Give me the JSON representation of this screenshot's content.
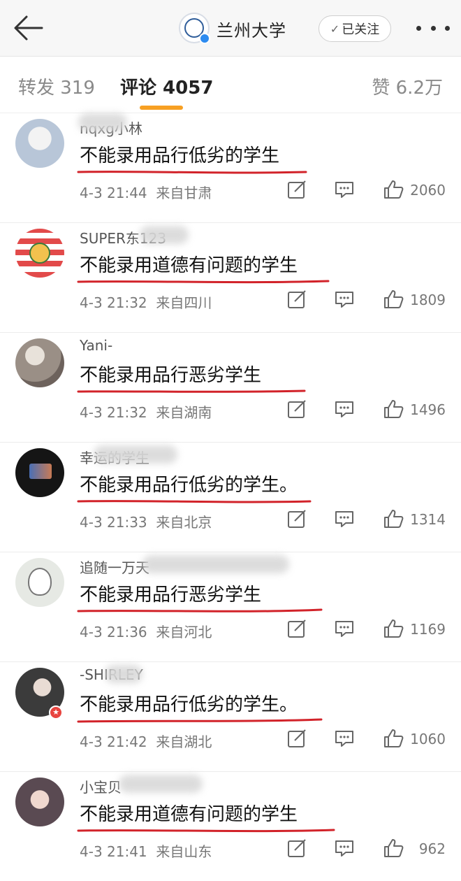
{
  "header": {
    "back_icon": "back-arrow-icon",
    "account_name": "兰州大学",
    "follow_label": "已关注",
    "follow_icon": "check-icon",
    "more_icon": "more-dots-icon"
  },
  "tabs": {
    "repost": "转发 319",
    "comments": "评论 4057",
    "likes": "赞 6.2万",
    "active_color": "#f7a023"
  },
  "annotation_color": "#d2232a",
  "comments": [
    {
      "username": "nqxg小林",
      "text": "不能录用品行低劣的学生",
      "time": "4-3 21:44",
      "location": "来自甘肃",
      "likes": "2060",
      "avatar_color": "#c9d6e6"
    },
    {
      "username": "SUPER东123",
      "text": "不能录用道德有问题的学生",
      "time": "4-3 21:32",
      "location": "来自四川",
      "likes": "1809",
      "avatar_color": "#e24a4a"
    },
    {
      "username": "Yani-",
      "text": "不能录用品行恶劣学生",
      "time": "4-3 21:32",
      "location": "来自湖南",
      "likes": "1496",
      "avatar_color": "#9a8f86"
    },
    {
      "username": "幸运的学生",
      "text": "不能录用品行低劣的学生。",
      "time": "4-3 21:33",
      "location": "来自北京",
      "likes": "1314",
      "avatar_color": "#151515"
    },
    {
      "username": "追随一万天",
      "text": "不能录用品行恶劣学生",
      "time": "4-3 21:36",
      "location": "来自河北",
      "likes": "1169",
      "avatar_color": "#dfe3de"
    },
    {
      "username": "-SHIRLEY",
      "text": "不能录用品行低劣的学生。",
      "time": "4-3 21:42",
      "location": "来自湖北",
      "likes": "1060",
      "avatar_color": "#3b3b3b"
    },
    {
      "username": "小宝贝",
      "text": "不能录用道德有问题的学生",
      "time": "4-3 21:41",
      "location": "来自山东",
      "likes": "962",
      "avatar_color": "#5a4a52"
    }
  ],
  "icons": {
    "share": "edit-share-icon",
    "reply": "comment-icon",
    "like": "thumbs-up-icon"
  }
}
